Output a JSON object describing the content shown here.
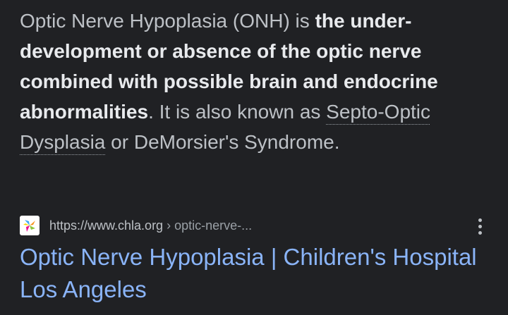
{
  "snippet": {
    "lead": "Optic Nerve Hypoplasia (ONH) is ",
    "bold": "the under-development or absence of the optic nerve combined with possible brain and endocrine abnormalities",
    "mid": ". It is also known as ",
    "link": "Septo-Optic Dysplasia",
    "tail": " or DeMorsier's Syndrome."
  },
  "source": {
    "url": "https://www.chla.org",
    "path": " › optic-nerve-...",
    "favicon_icon": "chla-flower-icon",
    "more_icon": "more-vert-icon"
  },
  "result": {
    "title": "Optic Nerve Hypoplasia | Children's Hospital Los Angeles"
  },
  "colors": {
    "background": "#202124",
    "text": "#bdc1c6",
    "link": "#8ab4f8"
  }
}
